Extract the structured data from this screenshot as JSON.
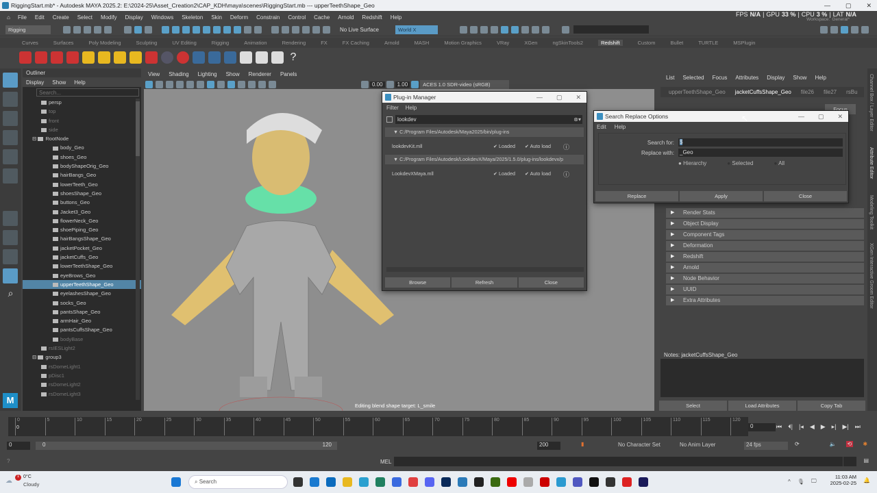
{
  "title": "RiggingStart.mb* - Autodesk MAYA 2025.2: E:\\2024-25\\Asset_Creation2\\CAP_KDH\\maya\\scenes\\RiggingStart.mb   ---   upperTeethShape_Geo",
  "menus": [
    "File",
    "Edit",
    "Create",
    "Select",
    "Modify",
    "Display",
    "Windows",
    "Skeleton",
    "Skin",
    "Deform",
    "Constrain",
    "Control",
    "Cache",
    "Arnold",
    "Redshift",
    "Help"
  ],
  "toolbar": {
    "mode": "Rigging",
    "live_surface": "No Live Surface",
    "world": "World X",
    "workspace_label": "Workspace:",
    "workspace": "General*"
  },
  "perf": {
    "fps_label": "FPS",
    "fps": "N/A",
    "gpu_label": "GPU",
    "gpu": "33 %",
    "cpu_label": "CPU",
    "cpu": "3 %",
    "lat_label": "LAT",
    "lat": "N/A"
  },
  "shelf_tabs": [
    "Curves",
    "Surfaces",
    "Poly Modeling",
    "Sculpting",
    "UV Editing",
    "Rigging",
    "Animation",
    "Rendering",
    "FX",
    "FX Caching",
    "Arnold",
    "MASH",
    "Motion Graphics",
    "VRay",
    "XGen",
    "ngSkinTools2",
    "Redshift",
    "Custom",
    "Bullet",
    "TURTLE",
    "MSPlugin"
  ],
  "shelf_active": "Redshift",
  "outliner": {
    "title": "Outliner",
    "menu": [
      "Display",
      "Show",
      "Help"
    ],
    "search_placeholder": "Search...",
    "items": [
      {
        "label": "persp",
        "indent": 1,
        "dim": false
      },
      {
        "label": "top",
        "indent": 1,
        "dim": true
      },
      {
        "label": "front",
        "indent": 1,
        "dim": true
      },
      {
        "label": "side",
        "indent": 1,
        "dim": true
      },
      {
        "label": "RootNode",
        "indent": 0,
        "dim": false
      },
      {
        "label": "body_Geo",
        "indent": 2
      },
      {
        "label": "shoes_Geo",
        "indent": 2
      },
      {
        "label": "bodyShapeOrig_Geo",
        "indent": 2
      },
      {
        "label": "hairBangs_Geo",
        "indent": 2
      },
      {
        "label": "lowerTeeth_Geo",
        "indent": 2
      },
      {
        "label": "shoesShape_Geo",
        "indent": 2
      },
      {
        "label": "buttons_Geo",
        "indent": 2
      },
      {
        "label": "Jacket3_Geo",
        "indent": 2
      },
      {
        "label": "flowerNeck_Geo",
        "indent": 2
      },
      {
        "label": "shoePiping_Geo",
        "indent": 2
      },
      {
        "label": "hairBangsShape_Geo",
        "indent": 2
      },
      {
        "label": "jacketPocket_Geo",
        "indent": 2
      },
      {
        "label": "jacketCuffs_Geo",
        "indent": 2
      },
      {
        "label": "lowerTeethShape_Geo",
        "indent": 2
      },
      {
        "label": "eyeBrows_Geo",
        "indent": 2
      },
      {
        "label": "upperTeethShape_Geo",
        "indent": 2,
        "selected": true
      },
      {
        "label": "eyelashesShape_Geo",
        "indent": 2
      },
      {
        "label": "socks_Geo",
        "indent": 2
      },
      {
        "label": "pantsShape_Geo",
        "indent": 2
      },
      {
        "label": "armHair_Geo",
        "indent": 2
      },
      {
        "label": "pantsCuffsShape_Geo",
        "indent": 2
      },
      {
        "label": "bodyBase",
        "indent": 2,
        "dim": true
      },
      {
        "label": "rsIESLight2",
        "indent": 1,
        "dim": true
      },
      {
        "label": "group3",
        "indent": 0
      },
      {
        "label": "rsDomeLight1",
        "indent": 1,
        "dim": true
      },
      {
        "label": "pDisc1",
        "indent": 1,
        "dim": true
      },
      {
        "label": "rsDomeLight2",
        "indent": 1,
        "dim": true
      },
      {
        "label": "rsDomeLight3",
        "indent": 1,
        "dim": true
      }
    ]
  },
  "viewport": {
    "menu": [
      "View",
      "Shading",
      "Lighting",
      "Show",
      "Renderer",
      "Panels"
    ],
    "exposure": "0.00",
    "gamma": "1.00",
    "colorspace": "ACES 1.0 SDR-video (sRGB)",
    "status": "Editing blend shape target: L_smile"
  },
  "plugin_manager": {
    "title": "Plug-in Manager",
    "menu": [
      "Filter",
      "Help"
    ],
    "filter": "lookdev",
    "groups": [
      {
        "path": "C:/Program Files/Autodesk/Maya2025/bin/plug-ins",
        "plugins": [
          {
            "name": "lookdevKit.mll",
            "loaded": true,
            "autoload": true
          }
        ]
      },
      {
        "path": "C:/Program Files/Autodesk/LookdevX/Maya/2025/1.5.0/plug-ins/lookdevx/p",
        "plugins": [
          {
            "name": "LookdevXMaya.mll",
            "loaded": true,
            "autoload": true
          }
        ]
      }
    ],
    "loaded_label": "Loaded",
    "autoload_label": "Auto load",
    "buttons": [
      "Browse",
      "Refresh",
      "Close"
    ]
  },
  "search_replace": {
    "title": "Search Replace Options",
    "menu": [
      "Edit",
      "Help"
    ],
    "search_label": "Search for:",
    "search_value": "$",
    "replace_label": "Replace with:",
    "replace_value": "_Geo",
    "scope": [
      "Hierarchy",
      "Selected",
      "All"
    ],
    "scope_selected": "Hierarchy",
    "buttons": [
      "Replace",
      "Apply",
      "Close"
    ]
  },
  "attribute_editor": {
    "menu": [
      "List",
      "Selected",
      "Focus",
      "Attributes",
      "Display",
      "Show",
      "Help"
    ],
    "tabs": [
      "upperTeethShape_Geo",
      "jacketCuffsShape_Geo",
      "file26",
      "file27",
      "rsBu"
    ],
    "active_tab": "jacketCuffsShape_Geo",
    "focus_label": "Focus",
    "sections": [
      "Render Stats",
      "Object Display",
      "Component Tags",
      "Deformation",
      "Redshift",
      "Arnold",
      "Node Behavior",
      "UUID",
      "Extra Attributes"
    ],
    "notes_label": "Notes:",
    "notes_node": "jacketCuffsShape_Geo",
    "buttons": [
      "Select",
      "Load Attributes",
      "Copy Tab"
    ]
  },
  "side_tabs": [
    "Channel Box / Layer Editor",
    "Attribute Editor",
    "Modeling Toolkit",
    "XGen Interactive Groom Editor"
  ],
  "timeline": {
    "ticks": [
      "0",
      "5",
      "10",
      "15",
      "20",
      "25",
      "30",
      "35",
      "40",
      "45",
      "50",
      "55",
      "60",
      "65",
      "70",
      "75",
      "80",
      "85",
      "90",
      "95",
      "100",
      "105",
      "110",
      "115",
      "120"
    ],
    "current": "0",
    "current_field": "0"
  },
  "range": {
    "start": "0",
    "inner_start": "0",
    "inner_end": "120",
    "end": "200",
    "character_set": "No Character Set",
    "anim_layer": "No Anim Layer",
    "fps": "24 fps"
  },
  "cmd": {
    "lang": "MEL"
  },
  "taskbar": {
    "weather_temp": "0°C",
    "weather_desc": "Cloudy",
    "weather_badge": "1",
    "search": "Search",
    "time": "11:03 AM",
    "date": "2025-02-25"
  }
}
